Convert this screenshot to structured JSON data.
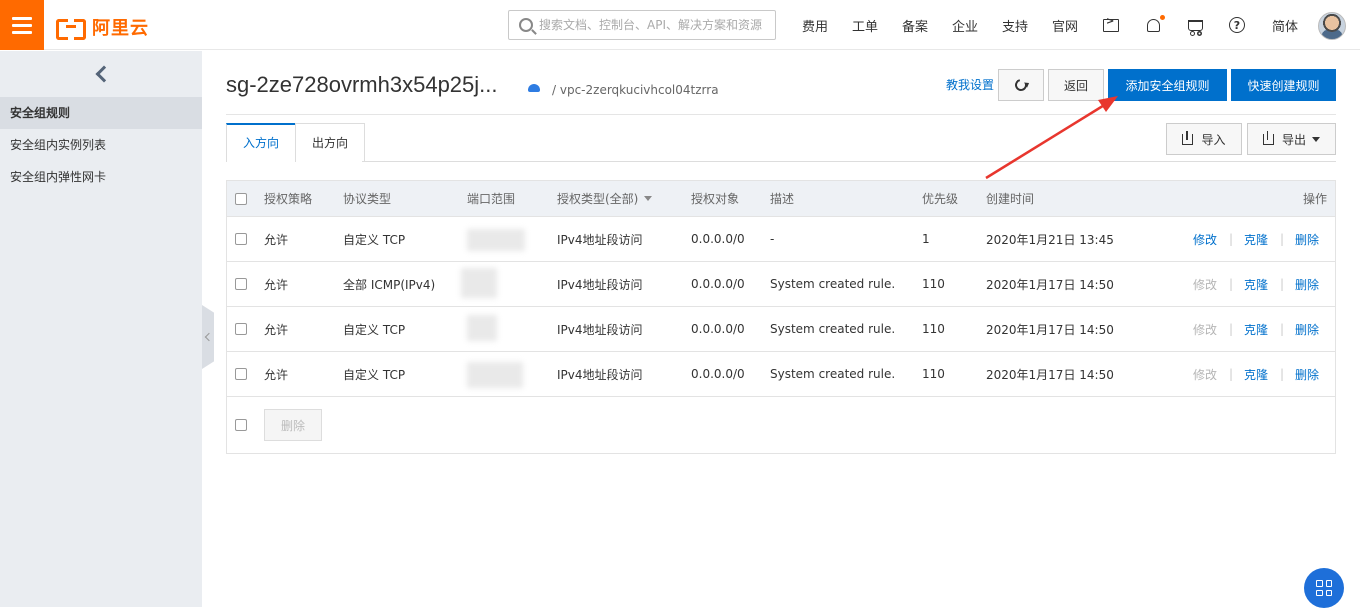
{
  "brand": {
    "logo_text": "阿里云",
    "accent": "#ff6a00",
    "primary": "#0070cc"
  },
  "search": {
    "placeholder": "搜索文档、控制台、API、解决方案和资源"
  },
  "nav": {
    "items": [
      "费用",
      "工单",
      "备案",
      "企业",
      "支持",
      "官网"
    ],
    "icons": [
      "terminal-icon",
      "bell-icon",
      "cart-icon",
      "help-icon"
    ],
    "lang": "简体"
  },
  "sidebar": {
    "items": [
      {
        "label": "安全组规则",
        "active": true
      },
      {
        "label": "安全组内实例列表",
        "active": false
      },
      {
        "label": "安全组内弹性网卡",
        "active": false
      }
    ]
  },
  "page": {
    "title": "sg-2ze728ovrmh3x54p25j...",
    "vpc": "/ vpc-2zerqkucivhcol04tzrra",
    "settings_link": "教我设置",
    "back_label": "返回",
    "add_rule_label": "添加安全组规则",
    "quick_create_label": "快速创建规则"
  },
  "tabs": {
    "inbound": "入方向",
    "outbound": "出方向"
  },
  "toolbar": {
    "import_label": "导入",
    "export_label": "导出"
  },
  "table": {
    "headers": {
      "policy": "授权策略",
      "protocol": "协议类型",
      "port": "端口范围",
      "auth_type": "授权类型(全部)",
      "target": "授权对象",
      "desc": "描述",
      "priority": "优先级",
      "created": "创建时间",
      "ops": "操作"
    },
    "rows": [
      {
        "policy": "允许",
        "protocol": "自定义 TCP",
        "port": "",
        "auth_type": "IPv4地址段访问",
        "target": "0.0.0.0/0",
        "desc": "-",
        "priority": "1",
        "created": "2020年1月21日 13:45",
        "edit": "修改",
        "clone": "克隆",
        "delete": "删除",
        "edit_enabled": true
      },
      {
        "policy": "允许",
        "protocol": "全部 ICMP(IPv4)",
        "port": "",
        "auth_type": "IPv4地址段访问",
        "target": "0.0.0.0/0",
        "desc": "System created rule.",
        "priority": "110",
        "created": "2020年1月17日 14:50",
        "edit": "修改",
        "clone": "克隆",
        "delete": "删除",
        "edit_enabled": false
      },
      {
        "policy": "允许",
        "protocol": "自定义 TCP",
        "port": "",
        "auth_type": "IPv4地址段访问",
        "target": "0.0.0.0/0",
        "desc": "System created rule.",
        "priority": "110",
        "created": "2020年1月17日 14:50",
        "edit": "修改",
        "clone": "克隆",
        "delete": "删除",
        "edit_enabled": false
      },
      {
        "policy": "允许",
        "protocol": "自定义 TCP",
        "port": "",
        "auth_type": "IPv4地址段访问",
        "target": "0.0.0.0/0",
        "desc": "System created rule.",
        "priority": "110",
        "created": "2020年1月17日 14:50",
        "edit": "修改",
        "clone": "克隆",
        "delete": "删除",
        "edit_enabled": false
      }
    ],
    "bulk_delete_label": "删除"
  },
  "annotation": {
    "arrow_color": "#e8362e"
  }
}
